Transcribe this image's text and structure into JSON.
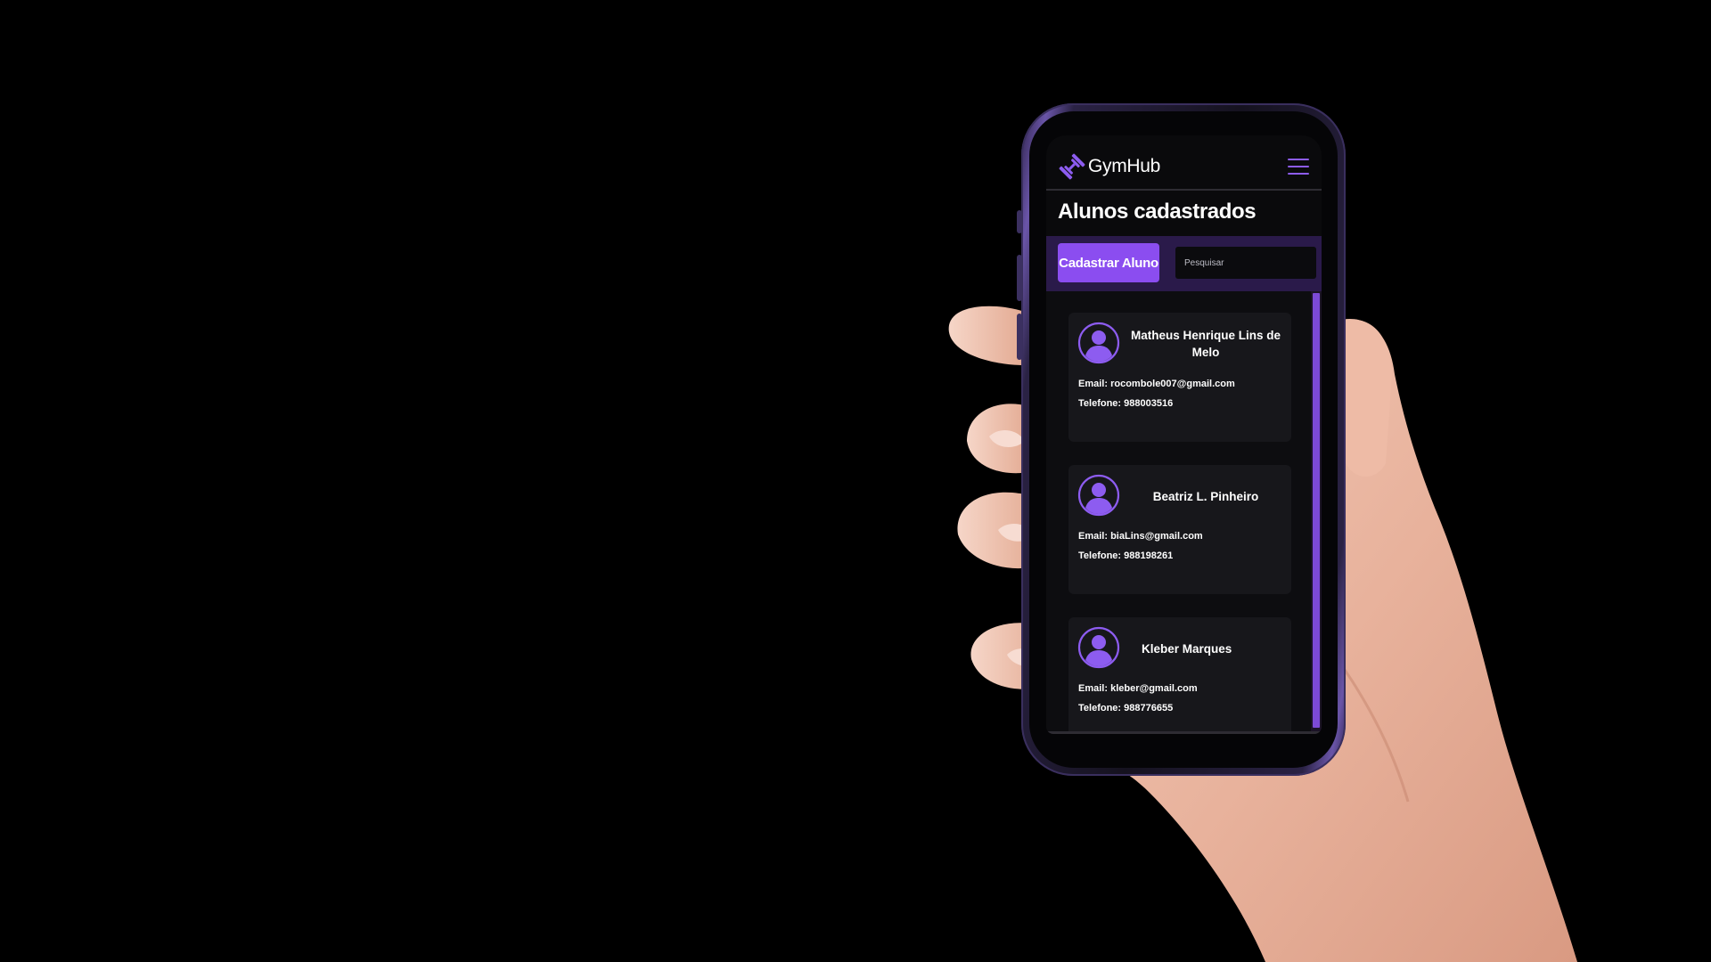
{
  "app": {
    "brand": "GymHub",
    "page_title": "Alunos cadastrados"
  },
  "toolbar": {
    "add_button_label": "Cadastrar Aluno",
    "search_placeholder": "Pesquisar"
  },
  "labels": {
    "email": "Email:",
    "phone": "Telefone:"
  },
  "students": [
    {
      "name": "Matheus Henrique Lins de Melo",
      "email": "rocombole007@gmail.com",
      "phone": "988003516"
    },
    {
      "name": "Beatriz L. Pinheiro",
      "email": "biaLins@gmail.com",
      "phone": "988198261"
    },
    {
      "name": "Kleber Marques",
      "email": "kleber@gmail.com",
      "phone": "988776655"
    }
  ],
  "colors": {
    "accent": "#8b4df0",
    "toolbar_bg": "#2a1a4a",
    "card_bg": "#17171b",
    "background": "#000000"
  },
  "icons": {
    "logo": "dumbbell-icon",
    "menu": "hamburger-menu-icon",
    "avatar": "user-avatar-icon"
  }
}
